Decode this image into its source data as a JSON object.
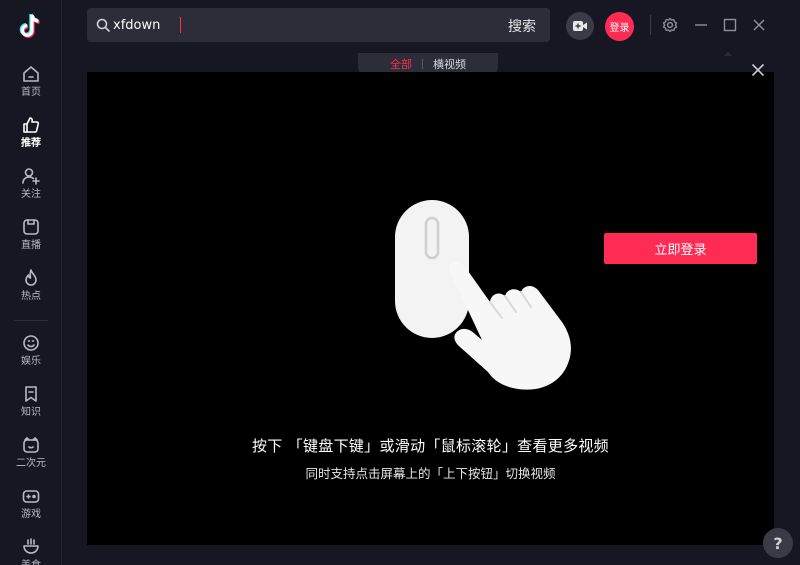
{
  "sidebar": {
    "items": [
      {
        "label": "首页",
        "icon": "home-icon"
      },
      {
        "label": "推荐",
        "icon": "thumbs-up-icon",
        "active": true
      },
      {
        "label": "关注",
        "icon": "follow-user-icon"
      },
      {
        "label": "直播",
        "icon": "live-tv-icon"
      },
      {
        "label": "热点",
        "icon": "flame-icon"
      },
      {
        "label": "娱乐",
        "icon": "smiley-icon"
      },
      {
        "label": "知识",
        "icon": "bookmark-icon"
      },
      {
        "label": "二次元",
        "icon": "anime-icon"
      },
      {
        "label": "游戏",
        "icon": "gamepad-icon"
      },
      {
        "label": "美食",
        "icon": "bowl-icon"
      }
    ]
  },
  "header": {
    "search": {
      "value": "xfdown",
      "button_label": "搜索"
    },
    "login_label": "登录"
  },
  "tabs": [
    {
      "label": "全部",
      "active": true
    },
    {
      "label": "横视频",
      "active": false
    }
  ],
  "main": {
    "login_button": "立即登录",
    "hint_main": "按下 「键盘下键」或滑动「鼠标滚轮」查看更多视频",
    "hint_sub": "同时支持点击屏幕上的「上下按钮」切换视频"
  },
  "help_label": "?",
  "colors": {
    "accent": "#fe2c55",
    "background": "#161722",
    "panel": "#000000"
  }
}
